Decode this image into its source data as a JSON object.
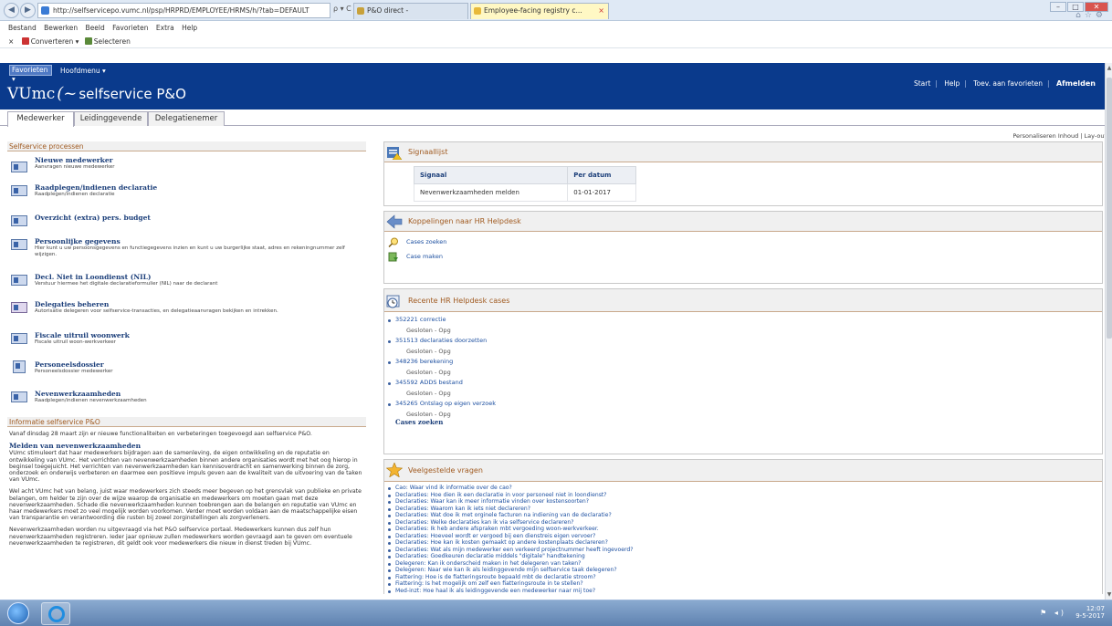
{
  "browser": {
    "address": "http://selfservicepo.vumc.nl/psp/HRPRD/EMPLOYEE/HRMS/h/?tab=DEFAULT",
    "address_controls": "ρ ▾ C",
    "tabs": [
      {
        "label": "P&O direct -"
      },
      {
        "label": "Employee-facing registry c...",
        "close": "×"
      }
    ],
    "menubar": [
      "Bestand",
      "Bewerken",
      "Beeld",
      "Favorieten",
      "Extra",
      "Help"
    ],
    "commandbar": {
      "close": "×",
      "convert": "Converteren",
      "dropdown": "▾",
      "select": "Selecteren"
    }
  },
  "header": {
    "favorites_label": "Favorieten",
    "mainmenu_label": "Hoofdmenu",
    "logo_main": "VUmc",
    "logo_swirl": "(~",
    "logo_sub": "selfservice P&O",
    "links": [
      "Start",
      "Help",
      "Toev. aan favorieten",
      "Afmelden"
    ],
    "accent_color": "#0a3a8c"
  },
  "page_tabs": [
    "Medewerker",
    "Leidinggevende",
    "Delegatienemer"
  ],
  "personalize": "Personaliseren Inhoud | Lay-out",
  "left": {
    "processes_title": "Selfservice processen",
    "processes": [
      {
        "title": "Nieuwe medewerker",
        "sub": "Aanvragen nieuwe medewerker"
      },
      {
        "title": "Raadplegen/indienen declaratie",
        "sub": "Raadplegen/indienen declaratie"
      },
      {
        "title": "Overzicht (extra) pers. budget",
        "sub": ""
      },
      {
        "title": "Persoonlijke gegevens",
        "sub": "Hier kunt u uw persoonsgegevens en functiegegevens inzien en kunt u uw burgerlijke staat, adres en rekeningnummer zelf wijzigen."
      },
      {
        "title": "Decl. Niet in Loondienst (NIL)",
        "sub": "Verstuur hiermee het digitale declaratieformulier (NIL) naar de declarant"
      },
      {
        "title": "Delegaties beheren",
        "sub": "Autorisatie delegeren voor selfservice-transacties, en delegatieaanvragen bekijken en intrekken."
      },
      {
        "title": "Fiscale uitruil woonwerk",
        "sub": "Fiscale uitruil woon-werkverkeer"
      },
      {
        "title": "Personeelsdossier",
        "sub": "Personeelsdossier medewerker"
      },
      {
        "title": "Nevenwerkzaamheden",
        "sub": "Raadplegen/indienen nevenwerkzaamheden"
      }
    ],
    "info_title": "Informatie selfservice P&O",
    "info_intro": "Vanaf dinsdag 28 maart zijn er nieuwe functionaliteiten en verbeteringen toegevoegd aan selfservice P&O.",
    "info_heading": "Melden van nevenwerkzaamheden",
    "info_p1": "VUmc stimuleert dat haar medewerkers bijdragen aan de samenleving, de eigen ontwikkeling en de reputatie en ontwikkeling van VUmc. Het verrichten van nevenwerkzaamheden binnen andere organisaties wordt met het oog hierop in beginsel toegejuicht. Het verrichten van nevenwerkzaamheden kan kennisoverdracht en samenwerking binnen de zorg, onderzoek en onderwijs verbeteren en daarmee een positieve impuls geven aan de kwaliteit van de uitvoering van de taken van VUmc.",
    "info_p2": "Wel acht VUmc het van belang, juist waar medewerkers zich steeds meer begeven op het grensvlak van publieke en private belangen, om helder te zijn over de wijze waarop de organisatie en medewerkers om moeten gaan met deze nevenwerkzaamheden. Schade die nevenwerkzaamheden kunnen toebrengen aan de belangen en reputatie van VUmc en haar medewerkers moet zo veel mogelijk worden voorkomen. Verder moet worden voldaan aan de maatschappelijke eisen van transparantie en verantwoording die rusten bij zowel zorginstellingen als zorgverleners.",
    "info_p3": "Nevenwerkzaamheden worden nu uitgevraagd via het P&O selfservice portaal. Medewerkers kunnen dus zelf hun nevenwerkzaamheden registreren. Ieder jaar opnieuw zullen medewerkers worden gevraagd aan te geven om eventuele nevenwerkzaamheden te registreren, dit geldt ook voor medewerkers die nieuw in dienst treden bij VUmc."
  },
  "right": {
    "signal_title": "Signaallijst",
    "signal_headers": [
      "Signaal",
      "Per datum"
    ],
    "signal_rows": [
      [
        "Nevenwerkzaamheden melden",
        "01-01-2017"
      ]
    ],
    "koppel_title": "Koppelingen naar HR Helpdesk",
    "koppel_links": [
      "Cases zoeken",
      "Case maken"
    ],
    "recent_title": "Recente HR Helpdesk cases",
    "cases": [
      {
        "id": "352221 correctie",
        "status": "Gesloten - Opg"
      },
      {
        "id": "351513 declaraties doorzetten",
        "status": "Gesloten - Opg"
      },
      {
        "id": "348236 berekening",
        "status": "Gesloten - Opg"
      },
      {
        "id": "345592 ADDS bestand",
        "status": "Gesloten - Opg"
      },
      {
        "id": "345265 Ontslag op eigen verzoek",
        "status": "Gesloten - Opg"
      }
    ],
    "cases_link": "Cases zoeken",
    "faq_title": "Veelgestelde vragen",
    "faq": [
      "Cao: Waar vind ik informatie over de cao?",
      "Declaraties: Hoe dien ik een declaratie in voor personeel niet in loondienst?",
      "Declaraties: Waar kan ik meer informatie vinden over kostensoorten?",
      "Declaraties: Waarom kan ik iets niet declareren?",
      "Declaraties: Wat doe ik met orginele facturen na indiening van de declaratie?",
      "Declaraties: Welke declaraties kan ik via selfservice declareren?",
      "Declaraties: Ik heb andere afspraken mbt vergoeding woon-werkverkeer.",
      "Declaraties: Hoeveel wordt er vergoed bij een dienstreis eigen vervoer?",
      "Declaraties: Hoe kan ik kosten gemaakt op andere kostenplaats declareren?",
      "Declaraties: Wat als mijn medewerker een verkeerd projectnummer heeft ingevoerd?",
      "Declaraties: Goedkeuren declaratie middels \"digitale\" handtekening",
      "Delegeren: Kan ik onderscheid maken in het delegeren van taken?",
      "Delegeren: Naar wie kan ik als leidinggevende mijn selfservice taak delegeren?",
      "Fiattering: Hoe is de fiatteringsroute bepaald mbt de declaratie stroom?",
      "Fiattering: Is het mogelijk om zelf een fiatteringsroute in te stellen?",
      "Med-inzt: Hoe haal ik als leidinggevende een medewerker naar mij toe?"
    ]
  },
  "taskbar": {
    "tray_icons": "⚑ ◂)",
    "time": "12:07",
    "date": "9-5-2017"
  }
}
